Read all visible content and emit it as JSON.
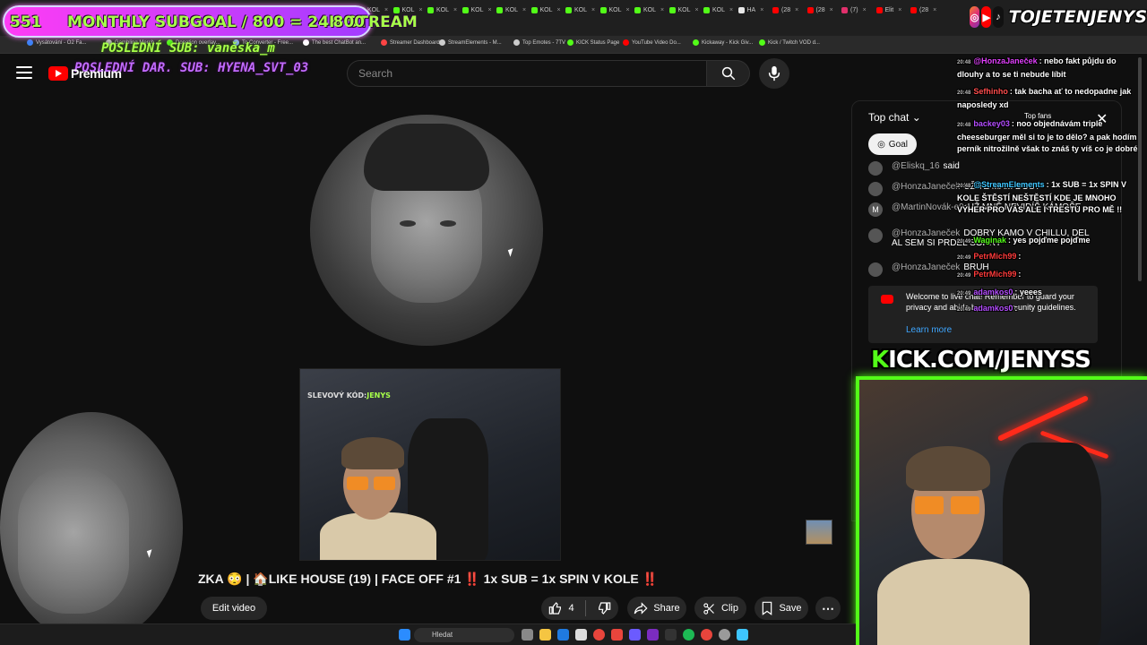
{
  "browser": {
    "tabs": [
      {
        "label": "KOL",
        "color": "#53fc18"
      },
      {
        "label": "KOL",
        "color": "#53fc18"
      },
      {
        "label": "KOL",
        "color": "#53fc18"
      },
      {
        "label": "KOL",
        "color": "#53fc18"
      },
      {
        "label": "KOL",
        "color": "#53fc18"
      },
      {
        "label": "KOL",
        "color": "#53fc18"
      },
      {
        "label": "KOL",
        "color": "#53fc18"
      },
      {
        "label": "KOL",
        "color": "#53fc18"
      },
      {
        "label": "KOL",
        "color": "#53fc18"
      },
      {
        "label": "KOL",
        "color": "#53fc18"
      },
      {
        "label": "KOL",
        "color": "#53fc18"
      },
      {
        "label": "HA",
        "color": "#e8e8e8"
      },
      {
        "label": "(28",
        "color": "#ff0000"
      },
      {
        "label": "(28",
        "color": "#ff0000"
      },
      {
        "label": "(7)",
        "color": "#e1306c"
      },
      {
        "label": "Elit",
        "color": "#ff0000"
      },
      {
        "label": "(28",
        "color": "#ff0000"
      }
    ],
    "bookmarks": [
      {
        "label": "Vysátování - O2 Fa...",
        "color": "#3b82f6"
      },
      {
        "label": "Gambling Merch...",
        "color": "#bbbbbb"
      },
      {
        "label": "Donation overlay...",
        "color": "#53fc18"
      },
      {
        "label": "To Converter - Free...",
        "color": "#8ab4f8"
      },
      {
        "label": "The best ChatBot an...",
        "color": "#ffffff"
      },
      {
        "label": "Streamer Dashboard",
        "color": "#ff4444"
      },
      {
        "label": "StreamElements - M...",
        "color": "#cccccc"
      },
      {
        "label": "Top Emotes - 7TV",
        "color": "#cccccc"
      },
      {
        "label": "KICK Status Page",
        "color": "#53fc18"
      },
      {
        "label": "YouTube Video Do...",
        "color": "#ff0000"
      },
      {
        "label": "Kickaway - Kick Giv...",
        "color": "#53fc18"
      },
      {
        "label": "Kick / Twitch VOD d...",
        "color": "#53fc18"
      }
    ]
  },
  "stream_overlay": {
    "subgoal_start": "551",
    "subgoal_title": "MONTHLY SUBGOAL / 800 = 24H STREAM",
    "subgoal_end": "800",
    "last_sub": "POSLEDNÍ SUB: vaněska_m",
    "last_donation": "POSLEDNÍ DAR. SUB: HYENA_SVT_03",
    "handle": "TOJETENJENYS",
    "kick_prefix": "K",
    "kick_url": "ICK.COM/JENYSS",
    "pip_code_label": "SLEVOVÝ KÓD:",
    "pip_code_value": "JENYS"
  },
  "youtube": {
    "brand": "Premium",
    "search_placeholder": "Search",
    "video_title": "ZKA 😳 | 🏠LIKE HOUSE (19) | FACE OFF #1 ‼️ 1x SUB = 1x SPIN V KOLE ‼️",
    "edit_video": "Edit video",
    "likes": "4",
    "share": "Share",
    "clip": "Clip",
    "save": "Save"
  },
  "live_chat": {
    "header": "Top chat",
    "goal_chip": "Goal",
    "top_fans": "Top fans",
    "rows": [
      {
        "user": "@Eliskq_16",
        "msg": "said",
        "initial": ""
      },
      {
        "user": "@HonzaJaneček",
        "msg": "UŽ TE MAM DOST",
        "initial": ""
      },
      {
        "user": "@MartinNovák-e9",
        "msg": "UŽ MNĚ NEVIDÍŠ KÁMOŠE",
        "initial": "M"
      },
      {
        "user": "@HonzaJaneček",
        "msg": "DOBRY KAMO V CHILLU, DEL AL SEM SI PRDEL SORRY",
        "initial": ""
      },
      {
        "user": "@HonzaJaneček",
        "msg": "BRUH",
        "initial": ""
      }
    ],
    "welcome_text": "Welcome to live chat! Remember to guard your privacy and abide by our community guidelines.",
    "learn_more": "Learn more"
  },
  "overlay_chat": [
    {
      "time": "20:48",
      "user": "@HonzaJaneček",
      "user_color": "#e040fb",
      "msg": ": nebo fakt půjdu do dlouhy a to se ti nebude líbit"
    },
    {
      "time": "20:48",
      "user": "Sefhinho",
      "user_color": "#ff4d4d",
      "msg": ": tak bacha ať to nedopadne jak naposledy xd"
    },
    {
      "time": "20:48",
      "user": "backey03",
      "user_color": "#b44dff",
      "msg": ": noo objednávám triple cheeseburger měl si to je to dělo? a pak hodím perník nitrožilně však to znáš ty víš co je dobré"
    },
    {
      "time": "20:48",
      "user": "@StreamElements",
      "user_color": "#3ec6ff",
      "msg": ": 1x SUB = 1x SPIN V KOLE ŠTĚSTÍ NEŠTĚSTÍ KDE JE MNOHO VÝHER PRO VÁS ALE I TRESTU PRO MĚ !!"
    },
    {
      "time": "20:49",
      "user": "Waginak",
      "user_color": "#53fc18",
      "msg": ": yes pojďme pojďme"
    },
    {
      "time": "20:49",
      "user": "PetrMich99",
      "user_color": "#ff3b3b",
      "msg": ":"
    },
    {
      "time": "20:49",
      "user": "PetrMich99",
      "user_color": "#ff3b3b",
      "msg": ":"
    },
    {
      "time": "20:49",
      "user": "adamkos0",
      "user_color": "#b44dff",
      "msg": ": yeees"
    },
    {
      "time": "20:49",
      "user": "adamkos0",
      "user_color": "#b44dff",
      "msg": ":"
    }
  ],
  "taskbar": {
    "search": "Hledat"
  }
}
